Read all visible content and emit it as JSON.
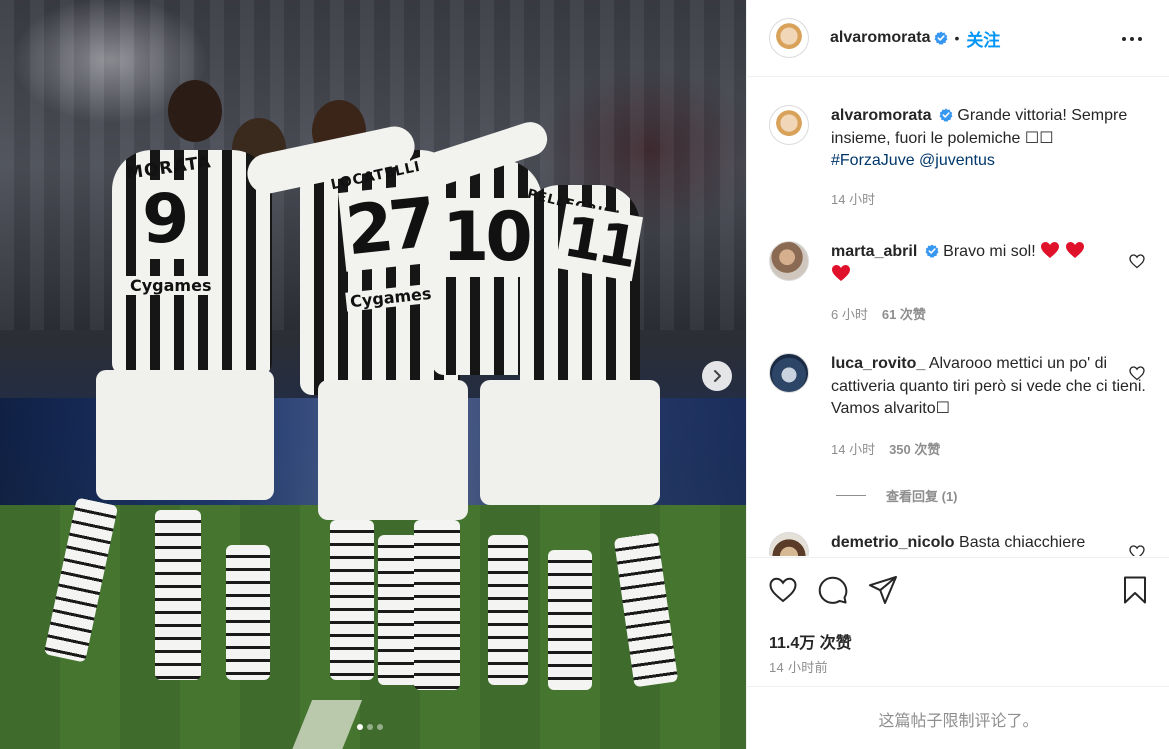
{
  "post": {
    "author": "alvaromorata",
    "follow_label": "关注",
    "separator": "•",
    "caption": "Grande vittoria! Sempre insieme, fuori le polemiche \u0000\u0000",
    "caption_text": "Grande vittoria! Sempre insieme, fuori le polemiche ",
    "caption_glyphs": "☐☐",
    "hashtag": "#ForzaJuve",
    "mention": "@juventus",
    "caption_time": "14 小时",
    "likes": "11.4万 次赞",
    "posted_ago": "14 小时前",
    "comments_limited": "这篇帖子限制评论了。"
  },
  "photo": {
    "player_names": [
      "MORATA",
      "PELLEGRINI",
      "LOCATELLI"
    ],
    "numbers": [
      "9",
      "27",
      "10",
      "11"
    ],
    "sponsor": "Cygames",
    "carousel_dots": 3,
    "active_dot": 0
  },
  "comments": [
    {
      "user": "marta_abril",
      "verified": true,
      "text": "Bravo mi sol! ",
      "hearts": 3,
      "time": "6 小时",
      "likes": "61 次赞"
    },
    {
      "user": "luca_rovito_",
      "verified": false,
      "text": "Alvarooo mettici un po' di cattiveria quanto tiri però si vede che ci tieni. Vamos alvarito☐",
      "time": "14 小时",
      "likes": "350 次赞",
      "view_replies": "查看回复 (1)"
    },
    {
      "user": "demetrio_nicolo",
      "verified": false,
      "text": "Basta chiacchiere"
    }
  ],
  "icons": {
    "more": "more-horizontal-icon",
    "verified": "verified-badge-icon",
    "like": "heart-outline-icon",
    "comment": "comment-bubble-icon",
    "share": "paper-plane-icon",
    "save": "bookmark-icon",
    "next": "chevron-right-icon"
  },
  "colors": {
    "accent_blue": "#0095f6",
    "verified_blue": "#3897f0",
    "heart_red": "#ed4956",
    "text_primary": "#262626",
    "text_secondary": "#8e8e8e",
    "border": "#efefef"
  }
}
